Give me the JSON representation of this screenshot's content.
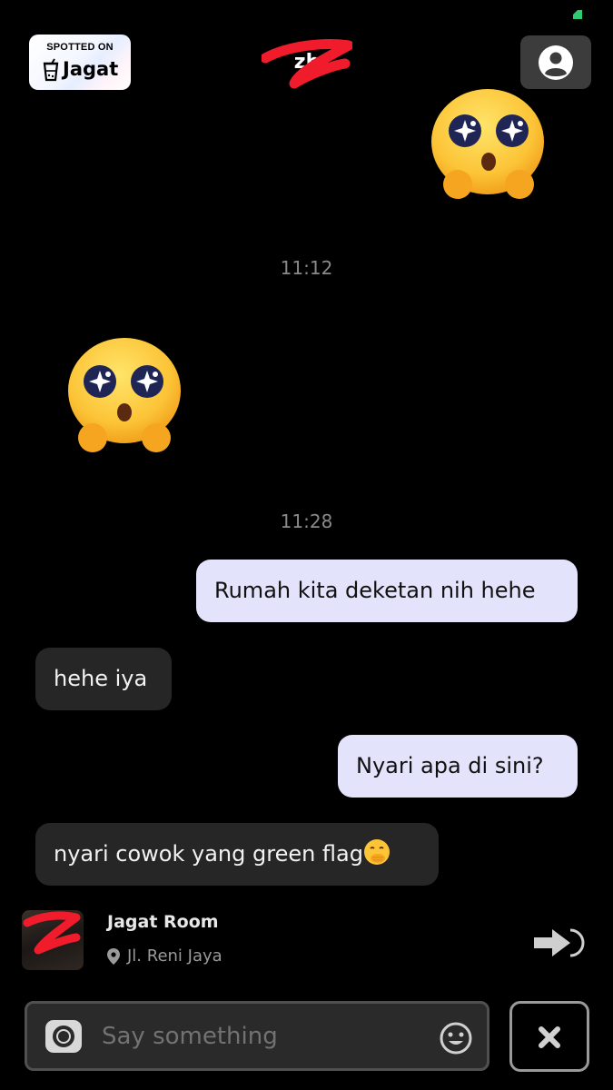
{
  "status_bar": {
    "battery_color": "#2ecc71"
  },
  "badge": {
    "top_text": "SPOTTED ON",
    "brand": "Jagat",
    "icon": "cup-icon"
  },
  "header": {
    "chat_name": "zh",
    "profile_icon": "user-avatar-icon"
  },
  "messages": [
    {
      "type": "emoji",
      "side": "right",
      "emoji": "shy-sparkle-eyes-emoji"
    },
    {
      "type": "timestamp",
      "text": "11:12"
    },
    {
      "type": "emoji",
      "side": "left",
      "emoji": "shy-sparkle-eyes-emoji"
    },
    {
      "type": "timestamp",
      "text": "11:28"
    },
    {
      "type": "text",
      "side": "right",
      "text": "Rumah kita deketan nih hehe"
    },
    {
      "type": "text",
      "side": "left",
      "text": "hehe iya"
    },
    {
      "type": "text",
      "side": "right",
      "text": "Nyari apa di sini?"
    },
    {
      "type": "text",
      "side": "left",
      "text": "nyari cowok yang green flag",
      "trailing_emoji": "hand-over-mouth-emoji"
    }
  ],
  "room": {
    "title": "Jagat Room",
    "location": "Jl. Reni Jaya",
    "pin_icon": "location-pin-icon",
    "go_icon": "arrow-right-icon"
  },
  "composer": {
    "placeholder": "Say something",
    "camera_icon": "camera-icon",
    "emoji_icon": "smile-icon",
    "close_icon": "close-icon"
  },
  "colors": {
    "bubble_out": "#e3e4fc",
    "bubble_in": "#262626",
    "background": "#000000"
  }
}
